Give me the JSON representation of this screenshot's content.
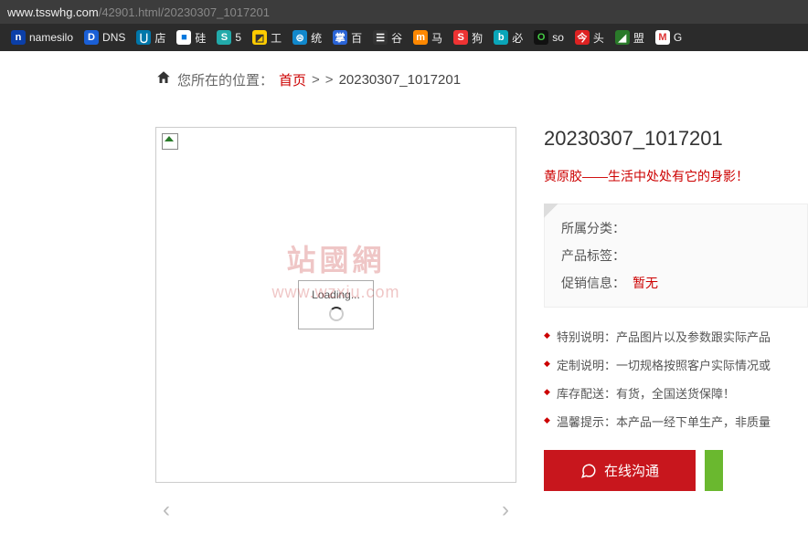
{
  "browser": {
    "url_domain": "www.tsswhg.com",
    "url_path": "/42901.html/20230307_1017201"
  },
  "bookmarks": [
    {
      "label": "namesilo",
      "icon_bg": "#0b3fa8",
      "icon_fg": "#fff",
      "glyph": "n"
    },
    {
      "label": "DNS",
      "icon_bg": "#1a5fd6",
      "icon_fg": "#fff",
      "glyph": "D"
    },
    {
      "label": "店",
      "icon_bg": "#07a",
      "icon_fg": "#fff",
      "glyph": "⋃"
    },
    {
      "label": "硅",
      "icon_bg": "#fff",
      "icon_fg": "#07d",
      "glyph": "■"
    },
    {
      "label": "5",
      "icon_bg": "#2aa",
      "icon_fg": "#fff",
      "glyph": "S"
    },
    {
      "label": "工",
      "icon_bg": "#fc0",
      "icon_fg": "#333",
      "glyph": "◩"
    },
    {
      "label": "统",
      "icon_bg": "#18c",
      "icon_fg": "#fff",
      "glyph": "⊜"
    },
    {
      "label": "百",
      "icon_bg": "#2a64d6",
      "icon_fg": "#fff",
      "glyph": "掌"
    },
    {
      "label": "谷",
      "icon_bg": "#333",
      "icon_fg": "#fff",
      "glyph": "☰"
    },
    {
      "label": "马",
      "icon_bg": "#f80",
      "icon_fg": "#fff",
      "glyph": "m"
    },
    {
      "label": "狗",
      "icon_bg": "#e33",
      "icon_fg": "#fff",
      "glyph": "S"
    },
    {
      "label": "必",
      "icon_bg": "#0aa5b8",
      "icon_fg": "#fff",
      "glyph": "b"
    },
    {
      "label": "so",
      "icon_bg": "#111",
      "icon_fg": "#4c4",
      "glyph": "O"
    },
    {
      "label": "头",
      "icon_bg": "#d22",
      "icon_fg": "#fff",
      "glyph": "今"
    },
    {
      "label": "盟",
      "icon_bg": "#2a7a2a",
      "icon_fg": "#fff",
      "glyph": "◢"
    },
    {
      "label": "G",
      "icon_bg": "#fff",
      "icon_fg": "#d33",
      "glyph": "M"
    }
  ],
  "breadcrumb": {
    "prefix": "您所在的位置：",
    "home": "首页",
    "sep": ">",
    "current": "20230307_1017201"
  },
  "watermark": {
    "line1": "站國網",
    "line2": "www.wzxiu.com"
  },
  "loader": {
    "text": "Loading..."
  },
  "product": {
    "title": "20230307_1017201",
    "subtitle": "黄原胶——生活中处处有它的身影！"
  },
  "meta": {
    "category_label": "所属分类：",
    "tags_label": "产品标签：",
    "promo_label": "促销信息：",
    "promo_value": "暂无"
  },
  "notes": [
    "特别说明：产品图片以及参数跟实际产品",
    "定制说明：一切规格按照客户实际情况或",
    "库存配送：有货，全国送货保障！",
    "温馨提示：本产品一经下单生产，非质量"
  ],
  "buttons": {
    "chat": "在线沟通"
  }
}
